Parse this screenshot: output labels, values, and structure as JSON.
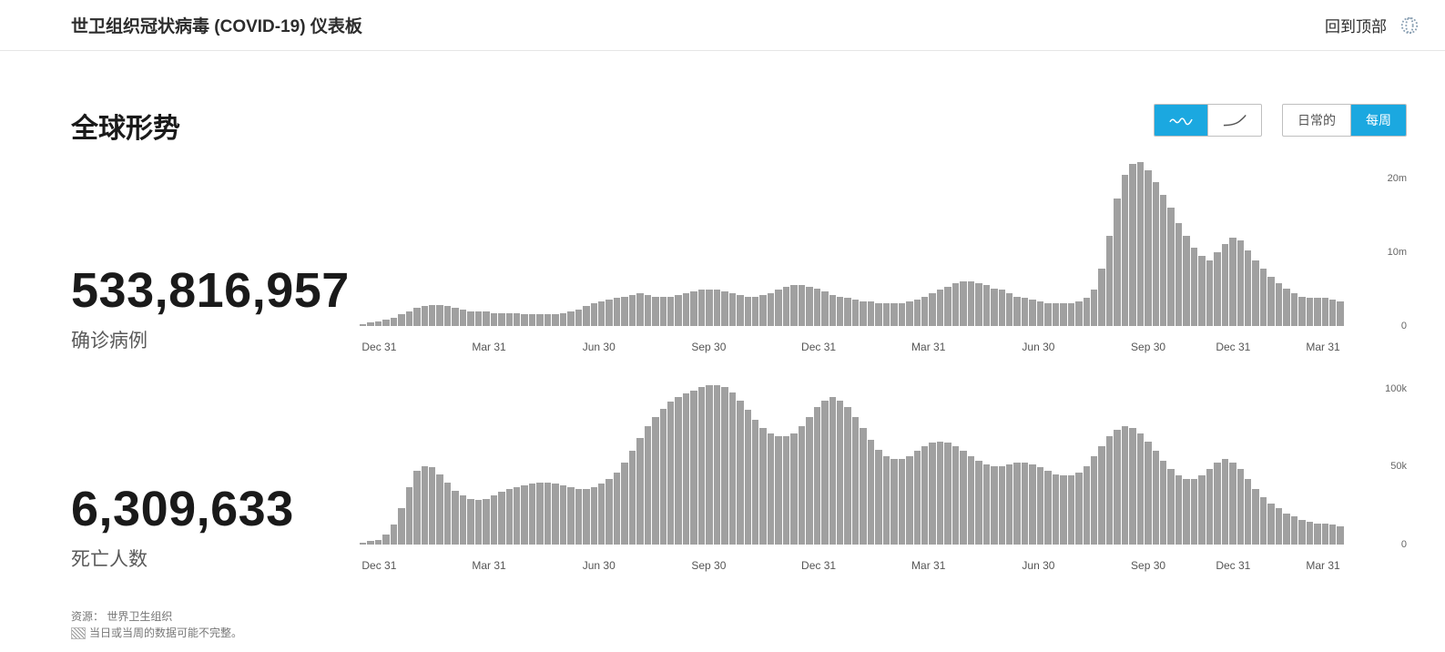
{
  "brand_color": "#1ba8e0",
  "topbar": {
    "title": "世卫组织冠状病毒 (COVID-19) 仪表板",
    "back_to_top": "回到顶部"
  },
  "section_title": "全球形势",
  "controls": {
    "daily": "日常的",
    "weekly": "每周"
  },
  "cases": {
    "value": "533,816,957",
    "label": "确诊病例"
  },
  "deaths": {
    "value": "6,309,633",
    "label": "死亡人数"
  },
  "footer": {
    "source": "资源： 世界卫生组织",
    "note": "当日或当周的数据可能不完整。"
  },
  "chart_data": [
    {
      "type": "bar",
      "title": "确诊病例",
      "ylim": [
        0,
        22000000
      ],
      "y_ticks": [
        {
          "label": "0",
          "frac": 0.0
        },
        {
          "label": "10m",
          "frac": 0.45
        },
        {
          "label": "20m",
          "frac": 0.9
        }
      ],
      "x_ticks": [
        {
          "label": "Dec 31",
          "frac": 0.035
        },
        {
          "label": "Mar 31",
          "frac": 0.145
        },
        {
          "label": "Jun 30",
          "frac": 0.255
        },
        {
          "label": "Sep 30",
          "frac": 0.365
        },
        {
          "label": "Dec 31",
          "frac": 0.475
        },
        {
          "label": "Mar 31",
          "frac": 0.585
        },
        {
          "label": "Jun 30",
          "frac": 0.695
        },
        {
          "label": "Sep 30",
          "frac": 0.805
        },
        {
          "label": "Dec 31",
          "frac": 0.89
        },
        {
          "label": "Mar 31",
          "frac": 0.98
        }
      ],
      "values": [
        0,
        0,
        0.01,
        0.02,
        0.03,
        0.04,
        0.05,
        0.07,
        0.09,
        0.11,
        0.12,
        0.13,
        0.13,
        0.12,
        0.11,
        0.1,
        0.09,
        0.09,
        0.09,
        0.08,
        0.08,
        0.08,
        0.08,
        0.07,
        0.07,
        0.07,
        0.07,
        0.07,
        0.08,
        0.09,
        0.1,
        0.12,
        0.14,
        0.15,
        0.16,
        0.17,
        0.18,
        0.19,
        0.2,
        0.19,
        0.18,
        0.18,
        0.18,
        0.19,
        0.2,
        0.21,
        0.22,
        0.22,
        0.22,
        0.21,
        0.2,
        0.19,
        0.18,
        0.18,
        0.19,
        0.2,
        0.22,
        0.24,
        0.25,
        0.25,
        0.24,
        0.23,
        0.21,
        0.19,
        0.18,
        0.17,
        0.16,
        0.15,
        0.15,
        0.14,
        0.14,
        0.14,
        0.14,
        0.15,
        0.16,
        0.18,
        0.2,
        0.22,
        0.24,
        0.26,
        0.27,
        0.27,
        0.26,
        0.25,
        0.23,
        0.22,
        0.2,
        0.18,
        0.17,
        0.16,
        0.15,
        0.14,
        0.14,
        0.14,
        0.14,
        0.15,
        0.17,
        0.22,
        0.35,
        0.55,
        0.78,
        0.92,
        0.99,
        1.0,
        0.95,
        0.88,
        0.8,
        0.72,
        0.63,
        0.55,
        0.48,
        0.43,
        0.4,
        0.45,
        0.5,
        0.54,
        0.52,
        0.46,
        0.4,
        0.35,
        0.3,
        0.26,
        0.23,
        0.2,
        0.18,
        0.17,
        0.17,
        0.17,
        0.16,
        0.15
      ]
    },
    {
      "type": "bar",
      "title": "死亡人数",
      "ylim": [
        0,
        105000
      ],
      "y_ticks": [
        {
          "label": "0",
          "frac": 0.0
        },
        {
          "label": "50k",
          "frac": 0.48
        },
        {
          "label": "100k",
          "frac": 0.95
        }
      ],
      "x_ticks": [
        {
          "label": "Dec 31",
          "frac": 0.035
        },
        {
          "label": "Mar 31",
          "frac": 0.145
        },
        {
          "label": "Jun 30",
          "frac": 0.255
        },
        {
          "label": "Sep 30",
          "frac": 0.365
        },
        {
          "label": "Dec 31",
          "frac": 0.475
        },
        {
          "label": "Mar 31",
          "frac": 0.585
        },
        {
          "label": "Jun 30",
          "frac": 0.695
        },
        {
          "label": "Sep 30",
          "frac": 0.805
        },
        {
          "label": "Dec 31",
          "frac": 0.89
        },
        {
          "label": "Mar 31",
          "frac": 0.98
        }
      ],
      "values": [
        0,
        0,
        0.01,
        0.02,
        0.03,
        0.06,
        0.12,
        0.22,
        0.35,
        0.45,
        0.48,
        0.47,
        0.43,
        0.38,
        0.33,
        0.3,
        0.28,
        0.27,
        0.28,
        0.3,
        0.32,
        0.34,
        0.35,
        0.36,
        0.37,
        0.38,
        0.38,
        0.37,
        0.36,
        0.35,
        0.34,
        0.34,
        0.35,
        0.37,
        0.4,
        0.44,
        0.5,
        0.57,
        0.65,
        0.72,
        0.78,
        0.83,
        0.87,
        0.9,
        0.92,
        0.94,
        0.96,
        0.97,
        0.97,
        0.96,
        0.93,
        0.88,
        0.82,
        0.76,
        0.71,
        0.68,
        0.66,
        0.66,
        0.68,
        0.72,
        0.78,
        0.84,
        0.88,
        0.9,
        0.88,
        0.84,
        0.78,
        0.71,
        0.64,
        0.58,
        0.54,
        0.52,
        0.52,
        0.54,
        0.57,
        0.6,
        0.62,
        0.63,
        0.62,
        0.6,
        0.57,
        0.54,
        0.51,
        0.49,
        0.48,
        0.48,
        0.49,
        0.5,
        0.5,
        0.49,
        0.47,
        0.45,
        0.43,
        0.42,
        0.42,
        0.44,
        0.48,
        0.54,
        0.6,
        0.66,
        0.7,
        0.72,
        0.71,
        0.68,
        0.63,
        0.57,
        0.51,
        0.46,
        0.42,
        0.4,
        0.4,
        0.42,
        0.46,
        0.5,
        0.52,
        0.5,
        0.46,
        0.4,
        0.34,
        0.29,
        0.25,
        0.22,
        0.19,
        0.17,
        0.15,
        0.14,
        0.13,
        0.13,
        0.12,
        0.11
      ]
    }
  ]
}
